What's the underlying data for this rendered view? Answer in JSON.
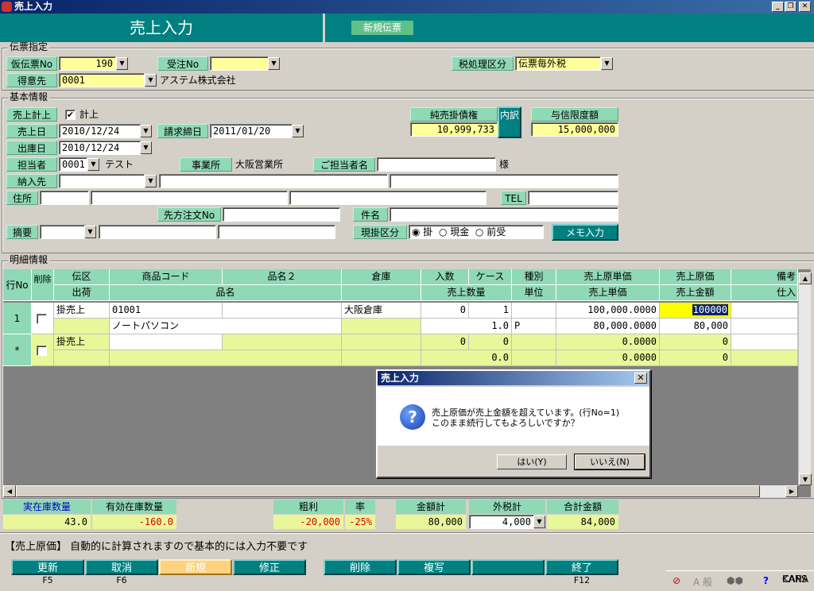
{
  "window": {
    "title": "売上入力",
    "min": "_",
    "max": "❐",
    "close": "✕"
  },
  "header": {
    "title": "売上入力",
    "mode_badge": "新規伝票"
  },
  "slip": {
    "legend": "伝票指定",
    "temp_slip_no_label": "仮伝票No",
    "temp_slip_no": "190",
    "order_no_label": "受注No",
    "order_no": "",
    "tax_label": "税処理区分",
    "tax_value": "伝票毎外税",
    "customer_label": "得意先",
    "customer_code": "0001",
    "customer_name": "アステム株式会社"
  },
  "basic": {
    "legend": "基本情報",
    "sales_post_label": "売上計上",
    "sales_post_check": "計上",
    "sales_post_mark": "✔",
    "sales_date_label": "売上日",
    "sales_date": "2010/12/24",
    "billing_close_label": "請求締日",
    "billing_close": "2011/01/20",
    "ship_date_label": "出庫日",
    "ship_date": "2010/12/24",
    "staff_label": "担当者",
    "staff_code": "0001",
    "staff_name": "テスト",
    "office_label": "事業所",
    "office_name": "大阪営業所",
    "contact_label": "ご担当者名",
    "contact_value": "",
    "contact_suffix": "様",
    "delivery_label": "納入先",
    "address_label": "住所",
    "tel_label": "TEL",
    "customer_order_label": "先方注文No",
    "subject_label": "件名",
    "summary_label": "摘要",
    "payment_label": "現掛区分",
    "payment_options": [
      "掛",
      "現金",
      "前受"
    ],
    "payment_selected": "掛",
    "memo_button": "メモ入力",
    "receivable_label": "純売掛債権",
    "receivable_value": "10,999,733",
    "breakdown_button": "内訳",
    "credit_label": "与信限度額",
    "credit_value": "15,000,000"
  },
  "detail": {
    "legend": "明細情報",
    "headers_top": [
      "行No",
      "削除",
      "伝区",
      "商品コード",
      "品名２",
      "倉庫",
      "入数",
      "ケース",
      "種別",
      "売上原単価",
      "売上原価",
      "備考"
    ],
    "headers_bottom": [
      "出荷",
      "品名",
      "売上数量",
      "単位",
      "売上単価",
      "売上金額",
      "仕入"
    ],
    "row1": {
      "row_no": "1",
      "slip_type": "掛売上",
      "product_code": "01001",
      "warehouse": "大阪倉庫",
      "per_case": "0",
      "cases": "1",
      "cost_unit_price": "100,000.0000",
      "cost": "100000",
      "product_name": "ノートパソコン",
      "quantity": "1.0",
      "unit": "P",
      "unit_price": "80,000.0000",
      "amount": "80,000"
    },
    "row_new": {
      "row_no": "*",
      "slip_type": "掛売上",
      "per_case": "0",
      "cases": "0",
      "cost_unit_price": "0.0000",
      "cost": "0",
      "quantity": "0.0",
      "unit_price": "0.0000",
      "amount": "0"
    }
  },
  "dialog": {
    "title": "売上入力",
    "line1": "売上原価が売上金額を超えています。(行No=1)",
    "line2": "このまま続行してもよろしいですか？",
    "yes": "はい(Y)",
    "no": "いいえ(N)"
  },
  "summary": {
    "actual_stock_label": "実在庫数量",
    "actual_stock": "43.0",
    "effective_stock_label": "有効在庫数量",
    "effective_stock": "-160.0",
    "gross_profit_label": "粗利",
    "gross_profit": "-20,000",
    "rate_label": "率",
    "rate": "-25%",
    "amount_total_label": "金額計",
    "amount_total": "80,000",
    "ext_tax_label": "外税計",
    "ext_tax": "4,000",
    "grand_total_label": "合計金額",
    "grand_total": "84,000"
  },
  "status_message": "【売上原価】 自動的に計算されますので基本的には入力不要です",
  "fkeys": [
    {
      "label": "更新",
      "key": "F5"
    },
    {
      "label": "取消",
      "key": "F6"
    },
    {
      "label": "新規",
      "key": ""
    },
    {
      "label": "修正",
      "key": ""
    },
    {
      "label": "削除",
      "key": ""
    },
    {
      "label": "複写",
      "key": ""
    },
    {
      "label": "",
      "key": ""
    },
    {
      "label": "終了",
      "key": "F12"
    }
  ],
  "tray": {
    "ime": "A 般",
    "caps": "CAPS",
    "kana": "KANA"
  },
  "colors": {
    "accent": "#008080",
    "label_bg": "#8fd9b6",
    "input_yellow": "#ffff99",
    "negative": "#e00000"
  }
}
